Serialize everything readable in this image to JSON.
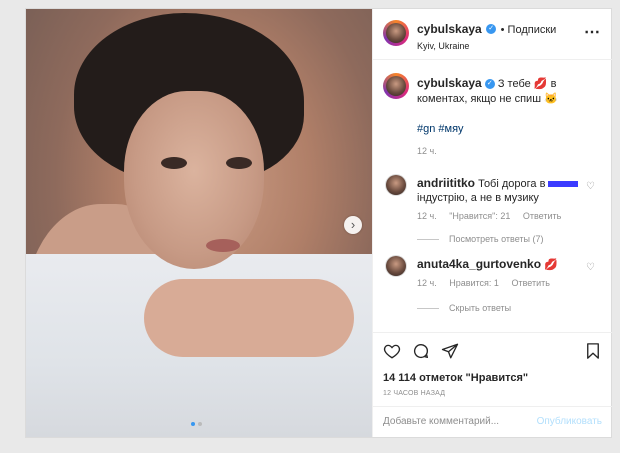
{
  "post": {
    "username": "cybulskaya",
    "follow_label": "• Подписки",
    "location": "Kyiv, Ukraine",
    "caption": {
      "text_part1": "З тебе",
      "emoji1": "💋",
      "text_part2": "в коментах,",
      "text_part3": "якщо не спиш",
      "emoji2": "🐱",
      "hashtags": "#gn #мяу",
      "time": "12 ч."
    },
    "comments": [
      {
        "username": "andriititko",
        "text_part1": "Тобі дорога в",
        "text_part2": "індустрію, а не в музику",
        "time": "12 ч.",
        "likes": "\"Нравится\": 21",
        "reply_label": "Ответить",
        "view_replies": "Посмотреть ответы (7)"
      },
      {
        "username": "anuta4ka_gurtovenko",
        "emoji": "💋",
        "time": "12 ч.",
        "likes": "Нравится: 1",
        "reply_label": "Ответить",
        "hide_replies": "Скрыть ответы"
      }
    ],
    "likes_count": "14 114 отметок \"Нравится\"",
    "posted_ago": "12 ЧАСОВ НАЗАД",
    "add_comment_placeholder": "Добавьте комментарий...",
    "publish_label": "Опубликовать",
    "more_icon": "⋯",
    "next_icon": "›",
    "icons": {
      "heart": "heart-icon",
      "comment": "comment-icon",
      "share": "share-icon",
      "bookmark": "bookmark-icon"
    }
  }
}
